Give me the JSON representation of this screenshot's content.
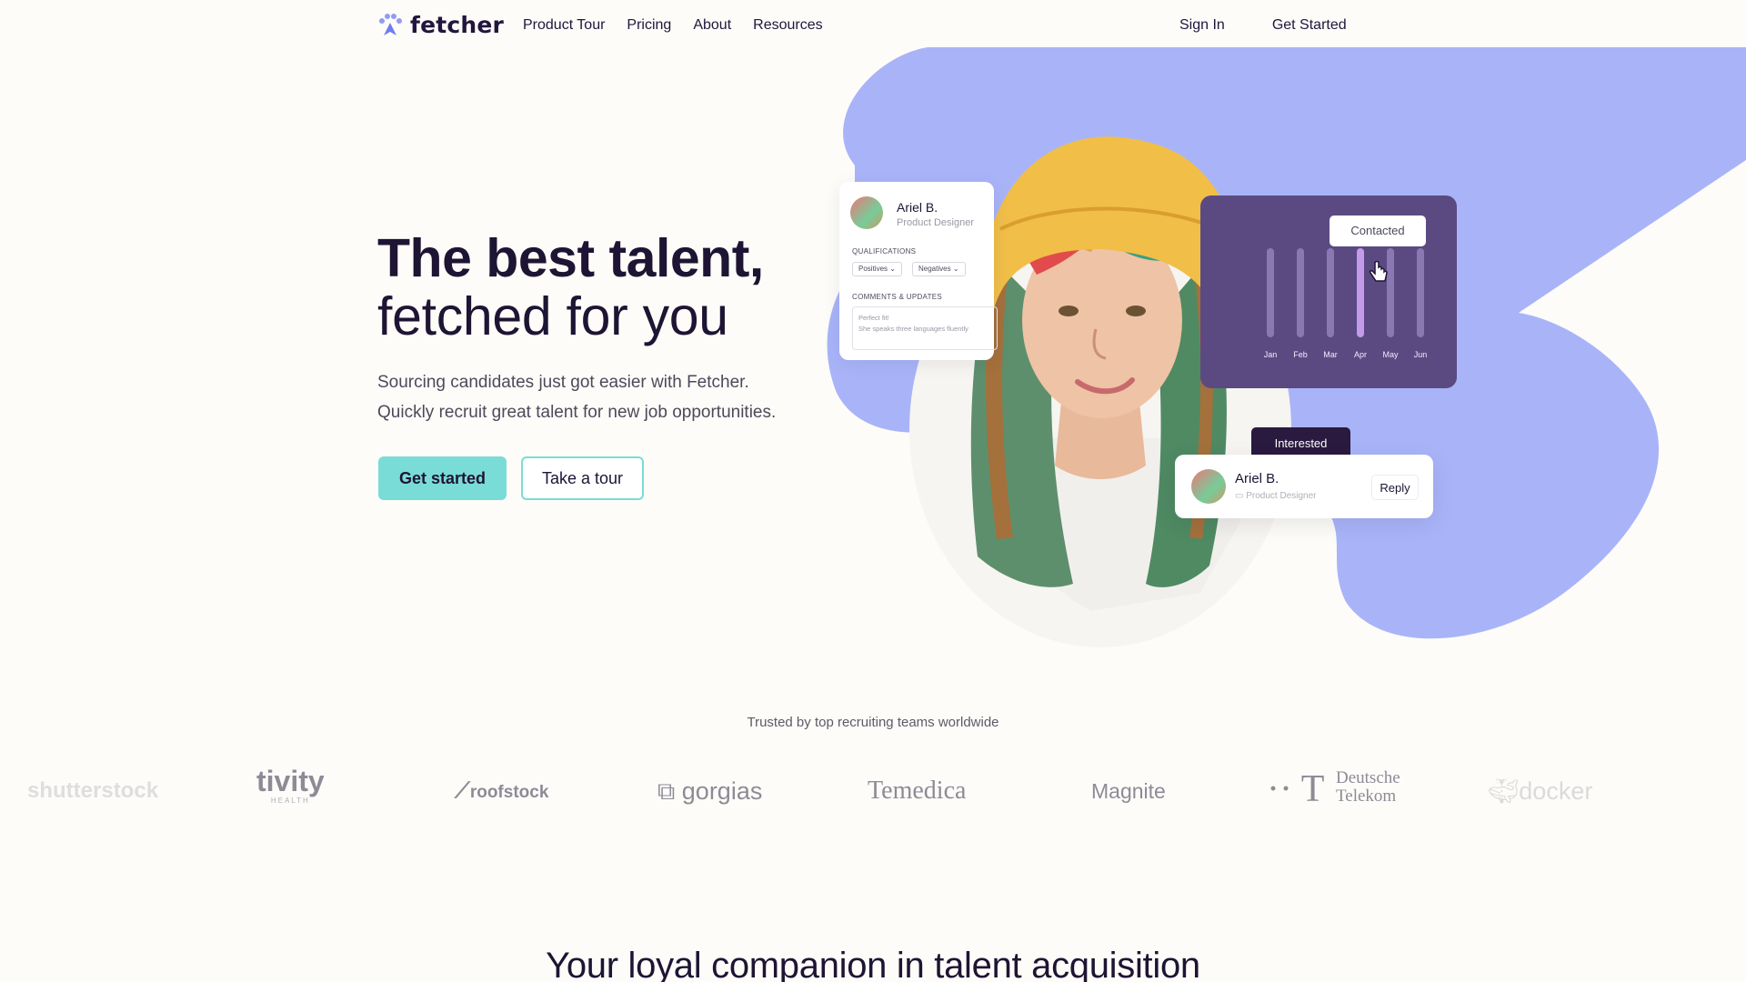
{
  "brand": {
    "name": "fetcher",
    "accent": "#7adcd6",
    "purple": "#a9b4f8",
    "dark": "#1e1433"
  },
  "nav": {
    "links": [
      "Product Tour",
      "Pricing",
      "About",
      "Resources"
    ],
    "sign_in": "Sign In",
    "get_started": "Get Started"
  },
  "hero": {
    "title_line1": "The best talent,",
    "title_line2": "fetched for you",
    "subtitle_line1": "Sourcing candidates just got easier with Fetcher.",
    "subtitle_line2": "Quickly recruit great talent for new job opportunities.",
    "cta_primary": "Get started",
    "cta_secondary": "Take a tour"
  },
  "profile_card": {
    "name": "Ariel B.",
    "role": "Product Designer",
    "qualifications_label": "QUALIFICATIONS",
    "chip_positive": "Positives",
    "chip_negative": "Negatives",
    "comments_label": "COMMENTS & UPDATES",
    "comment_line1": "Perfect fit!",
    "comment_line2": "She speaks three languages fluently"
  },
  "chart_card": {
    "tag": "Contacted",
    "months": [
      "Jan",
      "Feb",
      "Mar",
      "Apr",
      "May",
      "Jun"
    ],
    "highlight_month": "Apr"
  },
  "reply_card": {
    "status_tag": "Interested",
    "name": "Ariel B.",
    "role": "Product Designer",
    "reply_label": "Reply"
  },
  "trusted": {
    "heading": "Trusted by top recruiting teams worldwide",
    "logos": [
      "shutterstock",
      "tivity",
      "roofstock",
      "gorgias",
      "Temedica",
      "Magnite",
      "Deutsche Telekom",
      "docker"
    ],
    "tivity_sub": "HEALTH",
    "telekom_line1": "Deutsche",
    "telekom_line2": "Telekom"
  },
  "section2": {
    "title": "Your loyal companion in talent acquisition"
  }
}
